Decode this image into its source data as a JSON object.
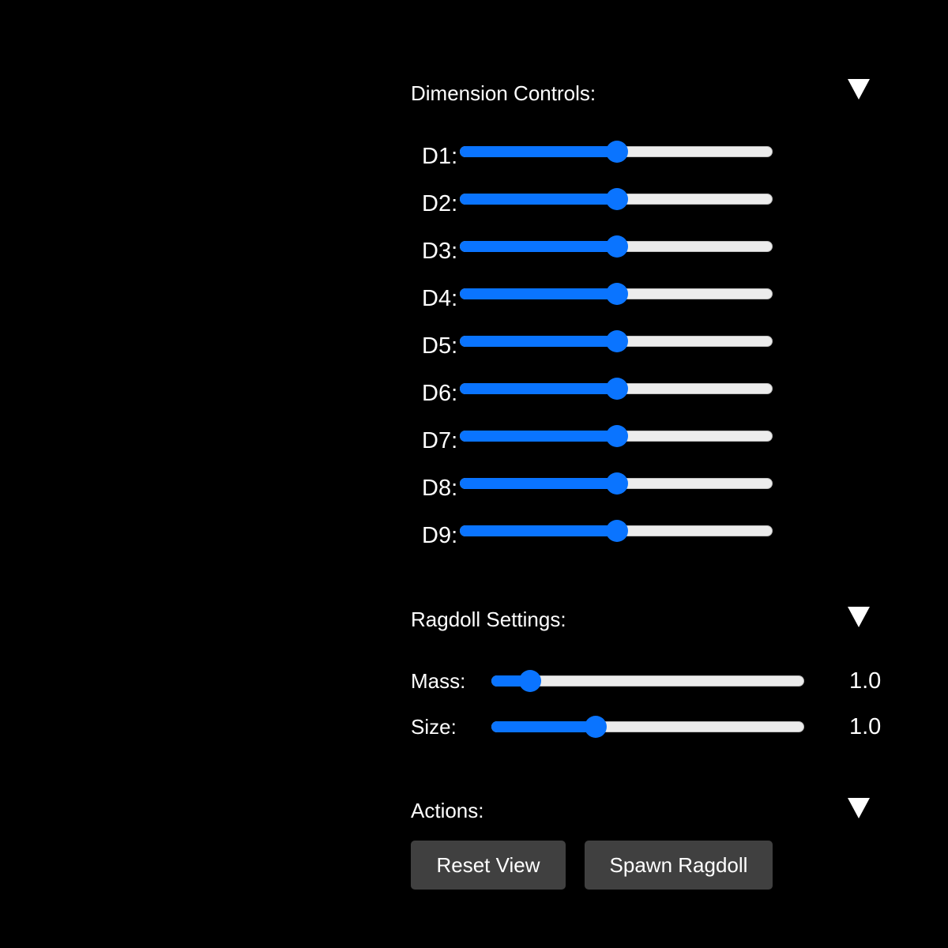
{
  "dimension_controls": {
    "title": "Dimension Controls:",
    "toggle_icon": "triangle-down-icon",
    "sliders": [
      {
        "label": "D1:",
        "value": 0.5
      },
      {
        "label": "D2:",
        "value": 0.5
      },
      {
        "label": "D3:",
        "value": 0.5
      },
      {
        "label": "D4:",
        "value": 0.5
      },
      {
        "label": "D5:",
        "value": 0.5
      },
      {
        "label": "D6:",
        "value": 0.5
      },
      {
        "label": "D7:",
        "value": 0.5
      },
      {
        "label": "D8:",
        "value": 0.5
      },
      {
        "label": "D9:",
        "value": 0.5
      }
    ]
  },
  "ragdoll_settings": {
    "title": "Ragdoll Settings:",
    "toggle_icon": "triangle-down-icon",
    "mass": {
      "label": "Mass:",
      "display": "1.0",
      "value": 0.12
    },
    "size": {
      "label": "Size:",
      "display": "1.0",
      "value": 0.33
    }
  },
  "actions": {
    "title": "Actions:",
    "toggle_icon": "triangle-down-icon",
    "reset_label": "Reset View",
    "spawn_label": "Spawn Ragdoll"
  },
  "colors": {
    "accent": "#0a74ff",
    "track": "#ececec",
    "button": "#404040",
    "background": "#000000"
  }
}
